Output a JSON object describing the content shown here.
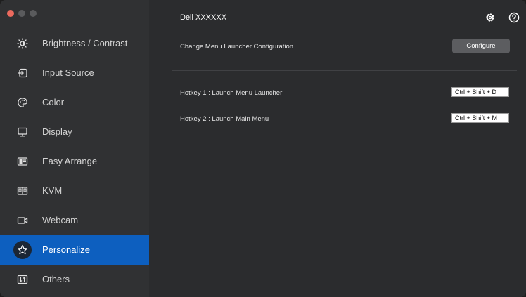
{
  "window": {
    "title": "Dell XXXXXX"
  },
  "sidebar": {
    "items": [
      {
        "label": "Brightness / Contrast",
        "icon": "brightness-icon"
      },
      {
        "label": "Input Source",
        "icon": "input-source-icon"
      },
      {
        "label": "Color",
        "icon": "color-palette-icon"
      },
      {
        "label": "Display",
        "icon": "monitor-icon"
      },
      {
        "label": "Easy Arrange",
        "icon": "easy-arrange-icon"
      },
      {
        "label": "KVM",
        "icon": "kvm-icon"
      },
      {
        "label": "Webcam",
        "icon": "webcam-icon"
      },
      {
        "label": "Personalize",
        "icon": "star-icon",
        "active": true
      },
      {
        "label": "Others",
        "icon": "others-icon"
      }
    ]
  },
  "main": {
    "launcher_config_label": "Change Menu Launcher Configuration",
    "configure_button": "Configure",
    "hotkey1_label": "Hotkey 1 : Launch Menu Launcher",
    "hotkey1_value": "Ctrl + Shift + D",
    "hotkey2_label": "Hotkey 2 : Launch Main Menu",
    "hotkey2_value": "Ctrl + Shift + M"
  },
  "colors": {
    "active_item": "#0d5fbf",
    "sidebar_bg": "#303133",
    "main_bg": "#2b2c2e",
    "close_button": "#ec6a5e"
  }
}
